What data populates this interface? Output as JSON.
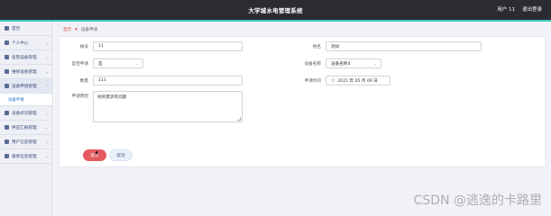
{
  "app": {
    "title": "大学城水电管理系统",
    "user_label": "用户 11",
    "logout_label": "退出登录"
  },
  "sidebar": {
    "items": [
      {
        "label": "首页"
      },
      {
        "label": "个人中心"
      },
      {
        "label": "宿管设备管理"
      },
      {
        "label": "维修设备管理"
      },
      {
        "label": "设备申请管理"
      },
      {
        "label": "设备申请"
      },
      {
        "label": "设备状况管理"
      },
      {
        "label": "供应汇报管理"
      },
      {
        "label": "用户信息管理"
      },
      {
        "label": "报修信息管理"
      }
    ]
  },
  "breadcrumb": {
    "home": "首页",
    "current": "设备申请"
  },
  "form": {
    "account_label": "账号",
    "account_value": "11",
    "name_label": "姓名",
    "name_value": "测试",
    "dorm_label": "是否申请",
    "dorm_value": "是",
    "device_label": "设备名称",
    "device_value": "设备名称4",
    "count_label": "数量",
    "count_value": "111",
    "time_label": "申请时间",
    "time_value": "2021 年 05 月 09 日",
    "desc_label": "申请原因",
    "desc_value": "他的需求有问题"
  },
  "buttons": {
    "submit": "提交",
    "cancel": "取消"
  },
  "watermark": "CSDN @逃逸的卡路里"
}
